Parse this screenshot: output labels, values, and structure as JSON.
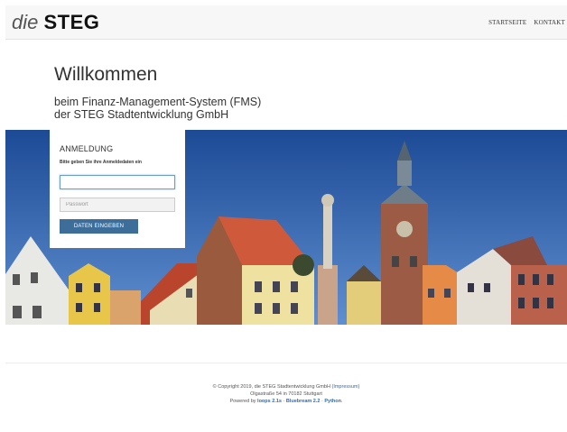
{
  "header": {
    "logo_die": "die",
    "logo_steg": "STEG",
    "nav": [
      "STARTSEITE",
      "KONTAKT"
    ]
  },
  "intro": {
    "title": "Willkommen",
    "subtitle_line1": "beim Finanz-Management-System (FMS)",
    "subtitle_line2": "der STEG Stadtentwicklung GmbH"
  },
  "login": {
    "title": "ANMELDUNG",
    "hint": "Bitte geben Sie ihre Anmeldedaten ein",
    "username_value": "",
    "password_placeholder": "Passwort",
    "submit_label": "DATEN EINGEBEN"
  },
  "footer": {
    "copyright_text": "© Copyright 2019, die STEG Stadtentwicklung GmbH (",
    "impressum_link": "Impressum",
    "copyright_close": ")",
    "address": "Olgastraße 54 in 70182 Stuttgart",
    "powered_by": "Powered by ",
    "loops_link": "loops 2.1s",
    "sep1": " · ",
    "bluebream_link": "Bluebream 2.2",
    "sep2": " · ",
    "python_link": "Python",
    "end": "."
  },
  "colors": {
    "button": "#3d6e9a",
    "link": "#2d6db5",
    "sky": "#1f4f9c"
  }
}
